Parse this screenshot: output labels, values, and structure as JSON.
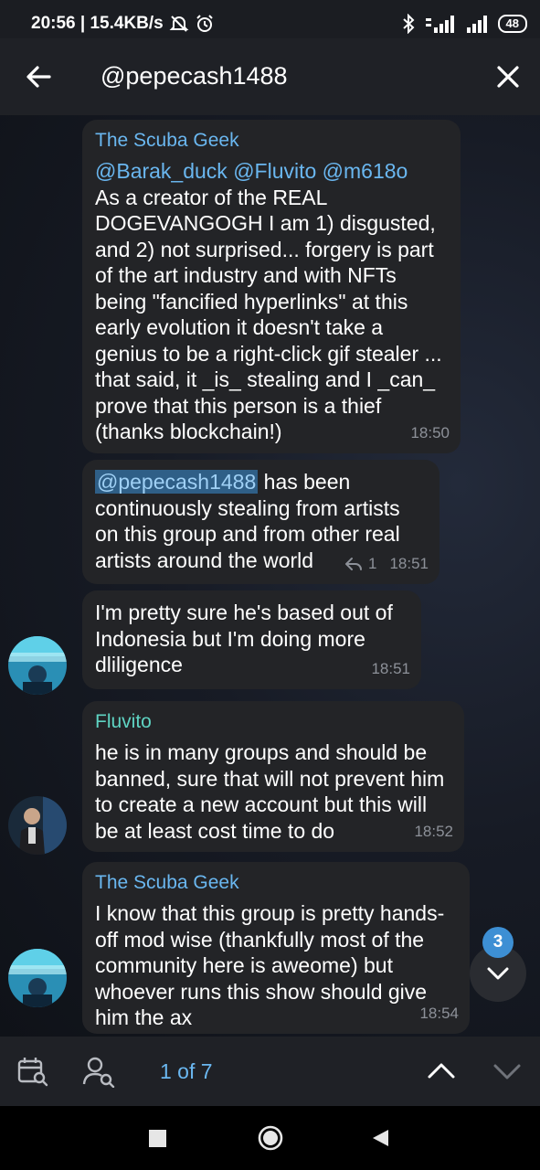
{
  "status_bar": {
    "time_speed": "20:56 | 15.4KB/s",
    "battery": "48"
  },
  "header": {
    "search_query": "@pepecash1488"
  },
  "messages": [
    {
      "sender": "The Scuba Geek",
      "mentions": "@Barak_duck @Fluvito @m618o",
      "text": "As a creator of the REAL DOGEVANGOGH I am 1) disgusted, and 2) not surprised... forgery is part of the art industry and with NFTs being \"fancified hyperlinks\" at this early evolution it doesn't take a genius to be a right-click gif stealer ... that said, it _is_ stealing and I _can_ prove that this person is a thief (thanks blockchain!)",
      "time": "18:50"
    },
    {
      "highlight": "@pepecash1488",
      "text": " has been continuously stealing from artists on this group and from other real artists around the world",
      "replies": "1",
      "time": "18:51"
    },
    {
      "text": "I'm pretty sure he's based out of Indonesia but I'm doing more dliligence",
      "time": "18:51"
    },
    {
      "sender": "Fluvito",
      "text": "he is in many groups and should be banned, sure that will not prevent him to create a new account but this will be at least cost time to do",
      "time": "18:52"
    },
    {
      "sender": "The Scuba Geek",
      "text": "I know that this group is pretty hands-off mod wise (thankfully most of the community here is aweome) but whoever runs this show should give him the ax",
      "time": "18:54"
    }
  ],
  "unread_badge": "3",
  "search_bar": {
    "counter": "1 of 7"
  },
  "icons": {
    "back": "arrow-left-icon",
    "close": "close-icon",
    "calendar": "calendar-search-icon",
    "user_search": "user-search-icon",
    "up": "chevron-up-icon",
    "down": "chevron-down-icon"
  },
  "colors": {
    "accent": "#6ab7f0",
    "teal_name": "#5fd4c3",
    "bubble": "#232427",
    "badge": "#3d8fd4"
  }
}
